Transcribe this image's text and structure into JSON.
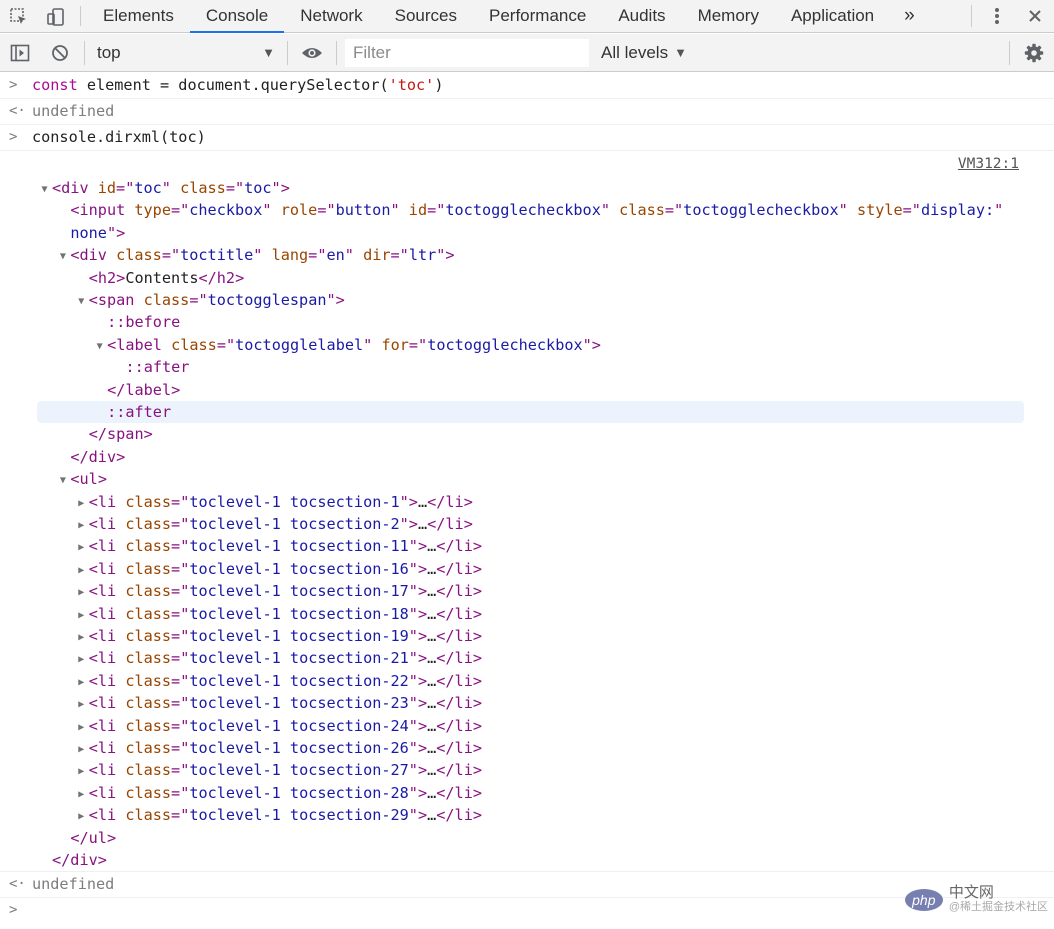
{
  "tabs": [
    {
      "label": "Elements",
      "active": false
    },
    {
      "label": "Console",
      "active": true
    },
    {
      "label": "Network",
      "active": false
    },
    {
      "label": "Sources",
      "active": false
    },
    {
      "label": "Performance",
      "active": false
    },
    {
      "label": "Audits",
      "active": false
    },
    {
      "label": "Memory",
      "active": false
    },
    {
      "label": "Application",
      "active": false
    }
  ],
  "tabbar": {
    "more_label": "»"
  },
  "toolbar": {
    "context_value": "top",
    "filter_placeholder": "Filter",
    "levels_label": "All levels",
    "caret": "▼"
  },
  "colors": {
    "accent": "#1a73e8",
    "tag": "#881280",
    "attr_name": "#994500",
    "attr_value": "#1a1aa6"
  },
  "console": {
    "input_prompt": ">",
    "result_prompt": "<·",
    "cmd1": {
      "kw": "const",
      "mid": " element = document.querySelector(",
      "str": "'toc'",
      "end": ")"
    },
    "result1": "undefined",
    "cmd2": "console.dirxml(toc)",
    "source_link": "VM312:1",
    "result2": "undefined",
    "prompt": ">"
  },
  "tree": {
    "div_open": {
      "tag": "div",
      "attrs": [
        [
          "id",
          "toc"
        ],
        [
          "class",
          "toc"
        ]
      ]
    },
    "input_open": {
      "tag": "input",
      "attrs": [
        [
          "type",
          "checkbox"
        ],
        [
          "role",
          "button"
        ],
        [
          "id",
          "toctogglecheckbox"
        ],
        [
          "class",
          "toctogglecheckbox"
        ],
        [
          "style",
          "display:"
        ]
      ],
      "wrap": "none"
    },
    "toctitle_open": {
      "tag": "div",
      "attrs": [
        [
          "class",
          "toctitle"
        ],
        [
          "lang",
          "en"
        ],
        [
          "dir",
          "ltr"
        ]
      ]
    },
    "h2": {
      "tag": "h2",
      "text": "Contents"
    },
    "span_open": {
      "tag": "span",
      "attrs": [
        [
          "class",
          "toctogglespan"
        ]
      ]
    },
    "pseudo_before": "::before",
    "label_open": {
      "tag": "label",
      "attrs": [
        [
          "class",
          "toctogglelabel"
        ],
        [
          "for",
          "toctogglecheckbox"
        ]
      ]
    },
    "pseudo_after_label": "::after",
    "label_close": "label",
    "pseudo_after_span": "::after",
    "span_close": "span",
    "div_close_inner": "div",
    "ul_open": "ul",
    "li_items": [
      "toclevel-1 tocsection-1",
      "toclevel-1 tocsection-2",
      "toclevel-1 tocsection-11",
      "toclevel-1 tocsection-16",
      "toclevel-1 tocsection-17",
      "toclevel-1 tocsection-18",
      "toclevel-1 tocsection-19",
      "toclevel-1 tocsection-21",
      "toclevel-1 tocsection-22",
      "toclevel-1 tocsection-23",
      "toclevel-1 tocsection-24",
      "toclevel-1 tocsection-26",
      "toclevel-1 tocsection-27",
      "toclevel-1 tocsection-28",
      "toclevel-1 tocsection-29"
    ],
    "li_tag": "li",
    "li_attr": "class",
    "ellipsis": "…",
    "ul_close": "ul",
    "div_close_outer": "div"
  },
  "watermark": {
    "badge": "php",
    "text": "中文网",
    "subtext": "@稀土掘金技术社区"
  }
}
